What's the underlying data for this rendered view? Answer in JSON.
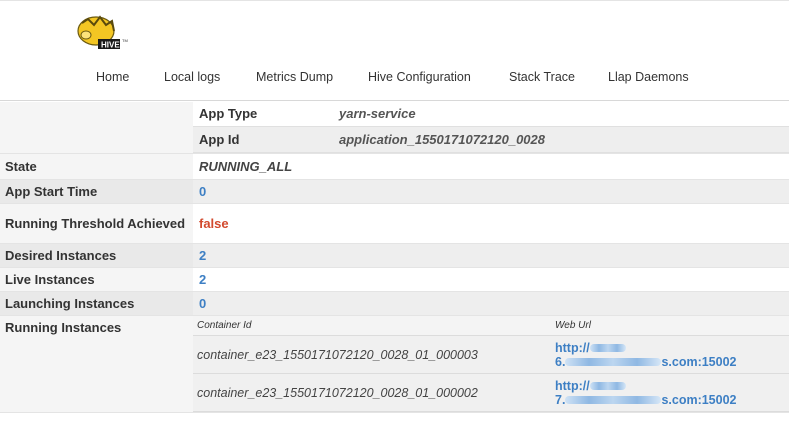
{
  "header": {
    "logo_text": "HIVE",
    "nav": [
      "Home",
      "Local logs",
      "Metrics Dump",
      "Hive Configuration",
      "Stack Trace",
      "Llap Daemons"
    ]
  },
  "app_info": [
    {
      "label": "App Type",
      "value": "yarn-service"
    },
    {
      "label": "App Id",
      "value": "application_1550171072120_0028"
    }
  ],
  "rows": {
    "state": {
      "label": "State",
      "value": "RUNNING_ALL"
    },
    "app_start_time": {
      "label": "App Start Time",
      "value": "0"
    },
    "running_threshold": {
      "label": "Running Threshold Achieved",
      "value": "false"
    },
    "desired_instances": {
      "label": "Desired Instances",
      "value": "2"
    },
    "live_instances": {
      "label": "Live Instances",
      "value": "2"
    },
    "launching_instances": {
      "label": "Launching Instances",
      "value": "0"
    },
    "running_instances": {
      "label": "Running Instances"
    }
  },
  "instances_table": {
    "headers": [
      "Container Id",
      "Web Url"
    ],
    "rows": [
      {
        "container_id": "container_e23_1550171072120_0028_01_000003",
        "url_line1": "http://",
        "url_line2_prefix": "6.",
        "url_line2_suffix": "s.com:15002"
      },
      {
        "container_id": "container_e23_1550171072120_0028_01_000002",
        "url_line1": "http://",
        "url_line2_prefix": "7.",
        "url_line2_suffix": "s.com:15002"
      }
    ]
  },
  "colors": {
    "link": "#3d7fc4",
    "false": "#d24a2e"
  }
}
